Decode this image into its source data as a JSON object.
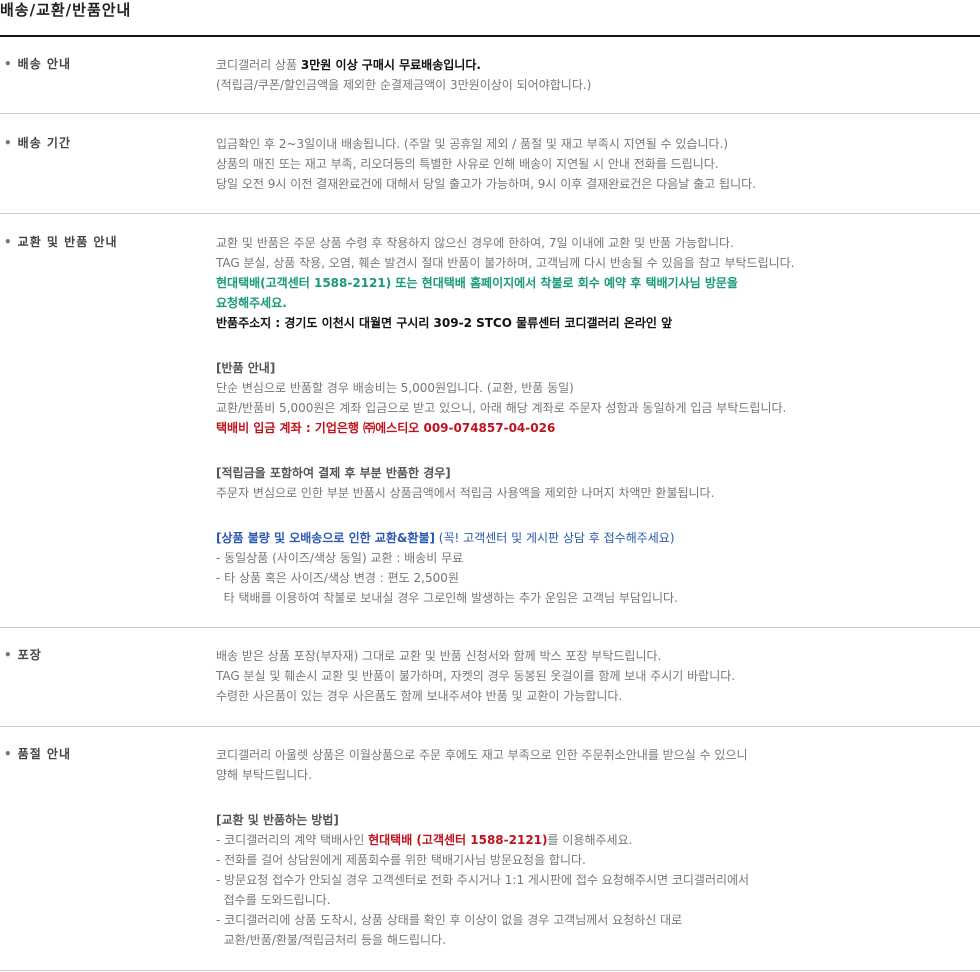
{
  "title": "배송/교환/반품안내",
  "bullet": "•",
  "shipping": {
    "label": "배송 안내",
    "line1_prefix": "코디갤러리 상품 ",
    "line1_bold": "3만원 이상 구매시 무료배송입니다.",
    "line2": "(적립금/쿠폰/할인금액을 제외한 순결제금액이 3만원이상이 되어야합니다.)"
  },
  "period": {
    "label": "배송 기간",
    "lines": [
      "입금확인 후 2~3일이내 배송됩니다. (주말 및 공휴일 제외 / 품절 및 재고 부족시 지연될 수 있습니다.)",
      "상품의 매진 또는 재고 부족, 리오더등의 특별한 사유로 인해 배송이 지연될 시 안내 전화를 드립니다.",
      "당일 오전 9시 이전 결재완료건에 대해서 당일 출고가 가능하며, 9시 이후 결재완료건은 다음날 출고 됩니다."
    ]
  },
  "exchange": {
    "label": "교환 및 반품 안내",
    "intro": [
      "교환 및 반품은 주문 상품 수령 후 착용하지 않으신 경우에 한하여, 7일 이내에 교환 및 반품 가능합니다.",
      "TAG 분실, 상품 착용, 오염, 훼손 발견시 절대 반품이 불가하며, 고객님께 다시 반송될 수 있음을 참고 부탁드립니다."
    ],
    "courier_line1": "현대택배(고객센터 1588-2121) 또는 현대택배 홈페이지에서 착불로 회수 예약 후 택배기사님 방문을",
    "courier_line2": "요청해주세요.",
    "address": "반품주소지 : 경기도 이천시 대월면 구시리 309-2 STCO 물류센터 코디갤러리 온라인 앞",
    "return_title": "[반품 안내]",
    "return_lines": [
      "단순 변심으로 반품할 경우 배송비는 5,000원입니다. (교환, 반품 동일)",
      "교환/반품비 5,000원은 계좌 입금으로 받고 있으니, 아래 해당 계좌로 주문자 성함과 동일하게 입금 부탁드립니다."
    ],
    "account": "택배비 입금 계좌 : 기업은행 ㈜에스티오 009-074857-04-026",
    "partial_title": "[적립금을 포함하여 결제 후 부분 반품한 경우]",
    "partial_line": "주문자 변심으로 인한 부분 반품시 상품금액에서 적립금 사용액을 제외한 나머지 차액만 환불됩니다.",
    "defect_title": "[상품 불량 및 오배송으로 인한 교환&환불]",
    "defect_note": " (꼭! 고객센터 및 게시판 상담 후 접수해주세요)",
    "defect_lines": [
      "- 동일상품 (사이즈/색상 동일) 교환 : 배송비 무료",
      "- 타 상품 혹은 사이즈/색상 변경 : 편도 2,500원",
      "  타 택배를 이용하여 착불로 보내실 경우 그로인해 발생하는 추가 운임은 고객님 부담입니다."
    ]
  },
  "packing": {
    "label": "포장",
    "lines": [
      "배송 받은 상품 포장(부자재) 그대로 교환 및 반품 신청서와 함께 박스 포장 부탁드립니다.",
      "TAG 분실 및 훼손시 교환 및 반품이 불가하며, 자켓의 경우 동봉된 옷걸이를 함께 보내 주시기 바랍니다.",
      "수령한 사은품이 있는 경우 사은품도 함께 보내주셔야 반품 및 교환이 가능합니다."
    ]
  },
  "soldout": {
    "label": "품절 안내",
    "lines": [
      "코디갤러리 아울렛 상품은 이월상품으로 주문 후에도 재고 부족으로 인한 주문취소안내를 받으실 수 있으니",
      "양해 부탁드립니다."
    ],
    "method_title": "[교환 및 반품하는 방법]",
    "method_line1_prefix": "- 코디갤러리의 계약 택배사인 ",
    "method_line1_red": "현대택배 (고객센터 1588-2121)",
    "method_line1_suffix": "를 이용해주세요.",
    "method_lines": [
      "- 전화를 걸어 상담원에게 제품회수를 위한 택배기사님 방문요청을 합니다.",
      "- 방문요청 접수가 안되실 경우 고객센터로 전화 주시거나 1:1 게시판에 접수 요청해주시면 코디갤러리에서",
      "  접수를 도와드립니다.",
      "- 코디갤러리에 상품 도착시, 상품 상태를 확인 후 이상이 없을 경우 고객님께서 요청하신 대로",
      "  교환/반품/환불/적립금처리 등을 해드립니다."
    ]
  }
}
